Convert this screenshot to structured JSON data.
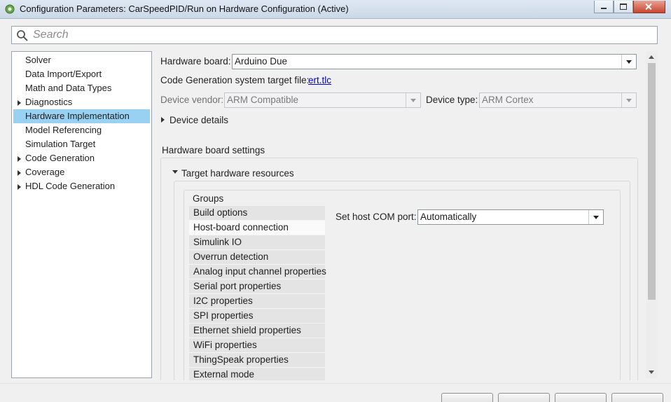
{
  "window": {
    "title": "Configuration Parameters: CarSpeedPID/Run on Hardware Configuration (Active)",
    "icon": "simulink-gear-icon"
  },
  "search": {
    "placeholder": "Search",
    "value": ""
  },
  "tree": {
    "items": [
      {
        "label": "Solver",
        "expandable": false,
        "selected": false
      },
      {
        "label": "Data Import/Export",
        "expandable": false,
        "selected": false
      },
      {
        "label": "Math and Data Types",
        "expandable": false,
        "selected": false
      },
      {
        "label": "Diagnostics",
        "expandable": true,
        "selected": false
      },
      {
        "label": "Hardware Implementation",
        "expandable": false,
        "selected": true
      },
      {
        "label": "Model Referencing",
        "expandable": false,
        "selected": false
      },
      {
        "label": "Simulation Target",
        "expandable": false,
        "selected": false
      },
      {
        "label": "Code Generation",
        "expandable": true,
        "selected": false
      },
      {
        "label": "Coverage",
        "expandable": true,
        "selected": false
      },
      {
        "label": "HDL Code Generation",
        "expandable": true,
        "selected": false
      }
    ]
  },
  "hardware": {
    "board_label": "Hardware board:",
    "board_value": "Arduino Due",
    "target_file_label": "Code Generation system target file:",
    "target_file_link": "ert.tlc",
    "vendor_label": "Device vendor:",
    "vendor_value": "ARM Compatible",
    "type_label": "Device type:",
    "type_value": "ARM Cortex",
    "device_details": "Device details",
    "board_settings": "Hardware board settings",
    "target_resources": "Target hardware resources",
    "groups_label": "Groups",
    "groups": [
      "Build options",
      "Host-board connection",
      "Simulink IO",
      "Overrun detection",
      "Analog input channel properties",
      "Serial port properties",
      "I2C properties",
      "SPI properties",
      "Ethernet shield properties",
      "WiFi properties",
      "ThingSpeak properties",
      "External mode"
    ],
    "selected_group_index": 1,
    "com_port_label": "Set host COM port:",
    "com_port_value": "Automatically"
  },
  "colors": {
    "selection": "#99d1f3",
    "link": "#0000cc"
  }
}
